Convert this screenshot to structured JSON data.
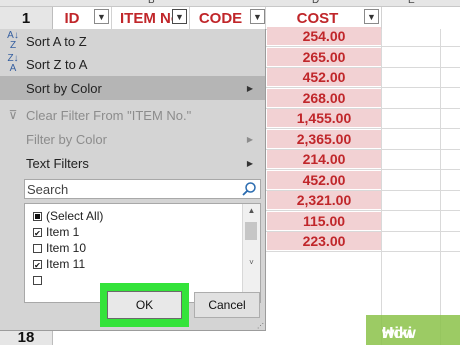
{
  "headers": {
    "row_number": "1",
    "id": "ID",
    "item_no": "ITEM No",
    "code": "CODE",
    "cost": "COST"
  },
  "column_letters": [
    "A",
    "B",
    "C",
    "D",
    "E"
  ],
  "cost_values": [
    "254.00",
    "265.00",
    "452.00",
    "268.00",
    "1,455.00",
    "2,365.00",
    "214.00",
    "452.00",
    "2,321.00",
    "115.00",
    "223.00"
  ],
  "bottom_row_number": "18",
  "menu": {
    "sort_az": "Sort A to Z",
    "sort_za": "Sort Z to A",
    "sort_color": "Sort by Color",
    "clear_filter": "Clear Filter From \"ITEM No.\"",
    "filter_color": "Filter by Color",
    "text_filters": "Text Filters"
  },
  "search": {
    "placeholder": "Search"
  },
  "list_items": [
    {
      "label": "(Select All)",
      "state": "partial"
    },
    {
      "label": "Item 1",
      "state": "checked"
    },
    {
      "label": "Item 10",
      "state": "unchecked"
    },
    {
      "label": "Item 11",
      "state": "checked"
    }
  ],
  "buttons": {
    "ok": "OK",
    "cancel": "Cancel"
  },
  "watermark": {
    "text_a": "wiki",
    "text_b": "How"
  },
  "colors": {
    "header_text": "#c0262a",
    "highlight": "#34e33a",
    "cost_fill": "#f2d1d3"
  },
  "icons": {
    "sort_az": "sort-ascending-icon",
    "sort_za": "sort-descending-icon",
    "clear_filter": "clear-filter-icon",
    "search": "magnifier-icon",
    "dropdown": "chevron-down-icon"
  }
}
